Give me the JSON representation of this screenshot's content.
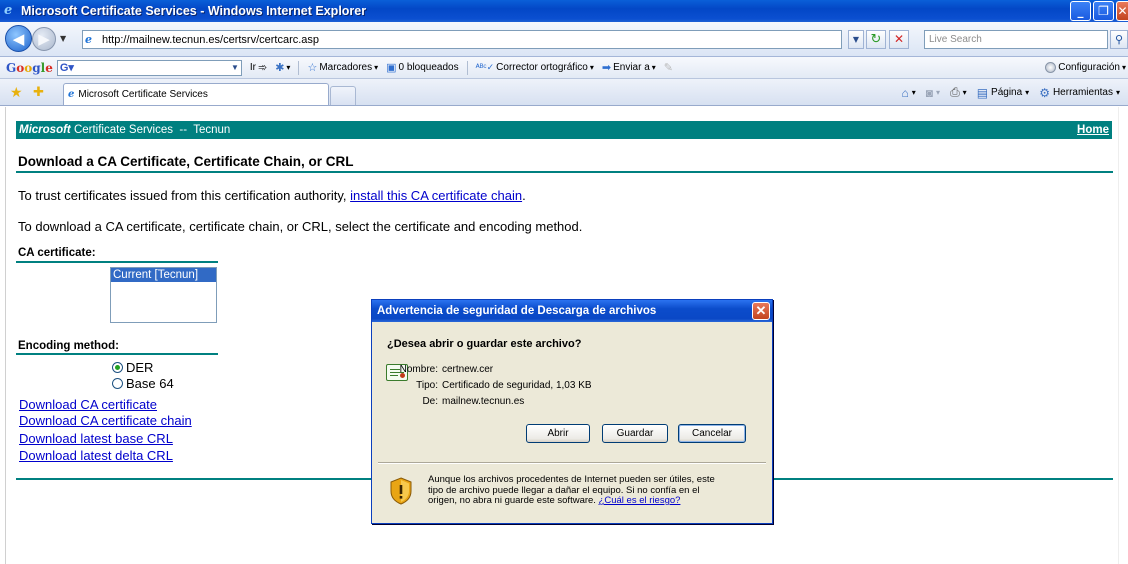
{
  "window": {
    "title": "Microsoft Certificate Services - Windows Internet Explorer"
  },
  "address": {
    "url": "http://mailnew.tecnun.es/certsrv/certcarc.asp",
    "search_placeholder": "Live Search"
  },
  "google_toolbar": {
    "go_label": "Ir",
    "bookmarks_label": "Marcadores",
    "blocked_label": "0 bloqueados",
    "spell_label": "Corrector ortográfico",
    "send_label": "Enviar a",
    "settings_label": "Configuración"
  },
  "tabs": [
    {
      "label": "Microsoft Certificate Services"
    }
  ],
  "commands": {
    "page_label": "Página",
    "tools_label": "Herramientas"
  },
  "page": {
    "header_ms": "Microsoft",
    "header_rest": " Certificate Services  --  Tecnun",
    "home_link": "Home",
    "heading": "Download a CA Certificate, Certificate Chain, or CRL",
    "trust_text_before": "To trust certificates issued from this certification authority, ",
    "trust_link": "install this CA certificate chain",
    "trust_text_after": ".",
    "download_text": "To download a CA certificate, certificate chain, or CRL, select the certificate and encoding method.",
    "ca_label": "CA certificate:",
    "ca_options": [
      "Current [Tecnun]"
    ],
    "encoding_label": "Encoding method:",
    "encoding_options": [
      "DER",
      "Base 64"
    ],
    "encoding_selected": "DER",
    "links": [
      "Download CA certificate",
      "Download CA certificate chain",
      "Download latest base CRL",
      "Download latest delta CRL"
    ]
  },
  "dialog": {
    "title": "Advertencia de seguridad de Descarga de archivos",
    "question": "¿Desea abrir o guardar este archivo?",
    "name_key": "Nombre:",
    "name_value": "certnew.cer",
    "type_key": "Tipo:",
    "type_value": "Certificado de seguridad, 1,03 KB",
    "from_key": "De:",
    "from_value": "mailnew.tecnun.es",
    "open_button": "Abrir",
    "save_button": "Guardar",
    "cancel_button": "Cancelar",
    "warning": "Aunque los archivos procedentes de Internet pueden ser útiles, este tipo de archivo puede llegar a dañar el equipo. Si no confía en el origen, no abra ni guarde este software. ",
    "risk_link": "¿Cuál es el riesgo?"
  }
}
